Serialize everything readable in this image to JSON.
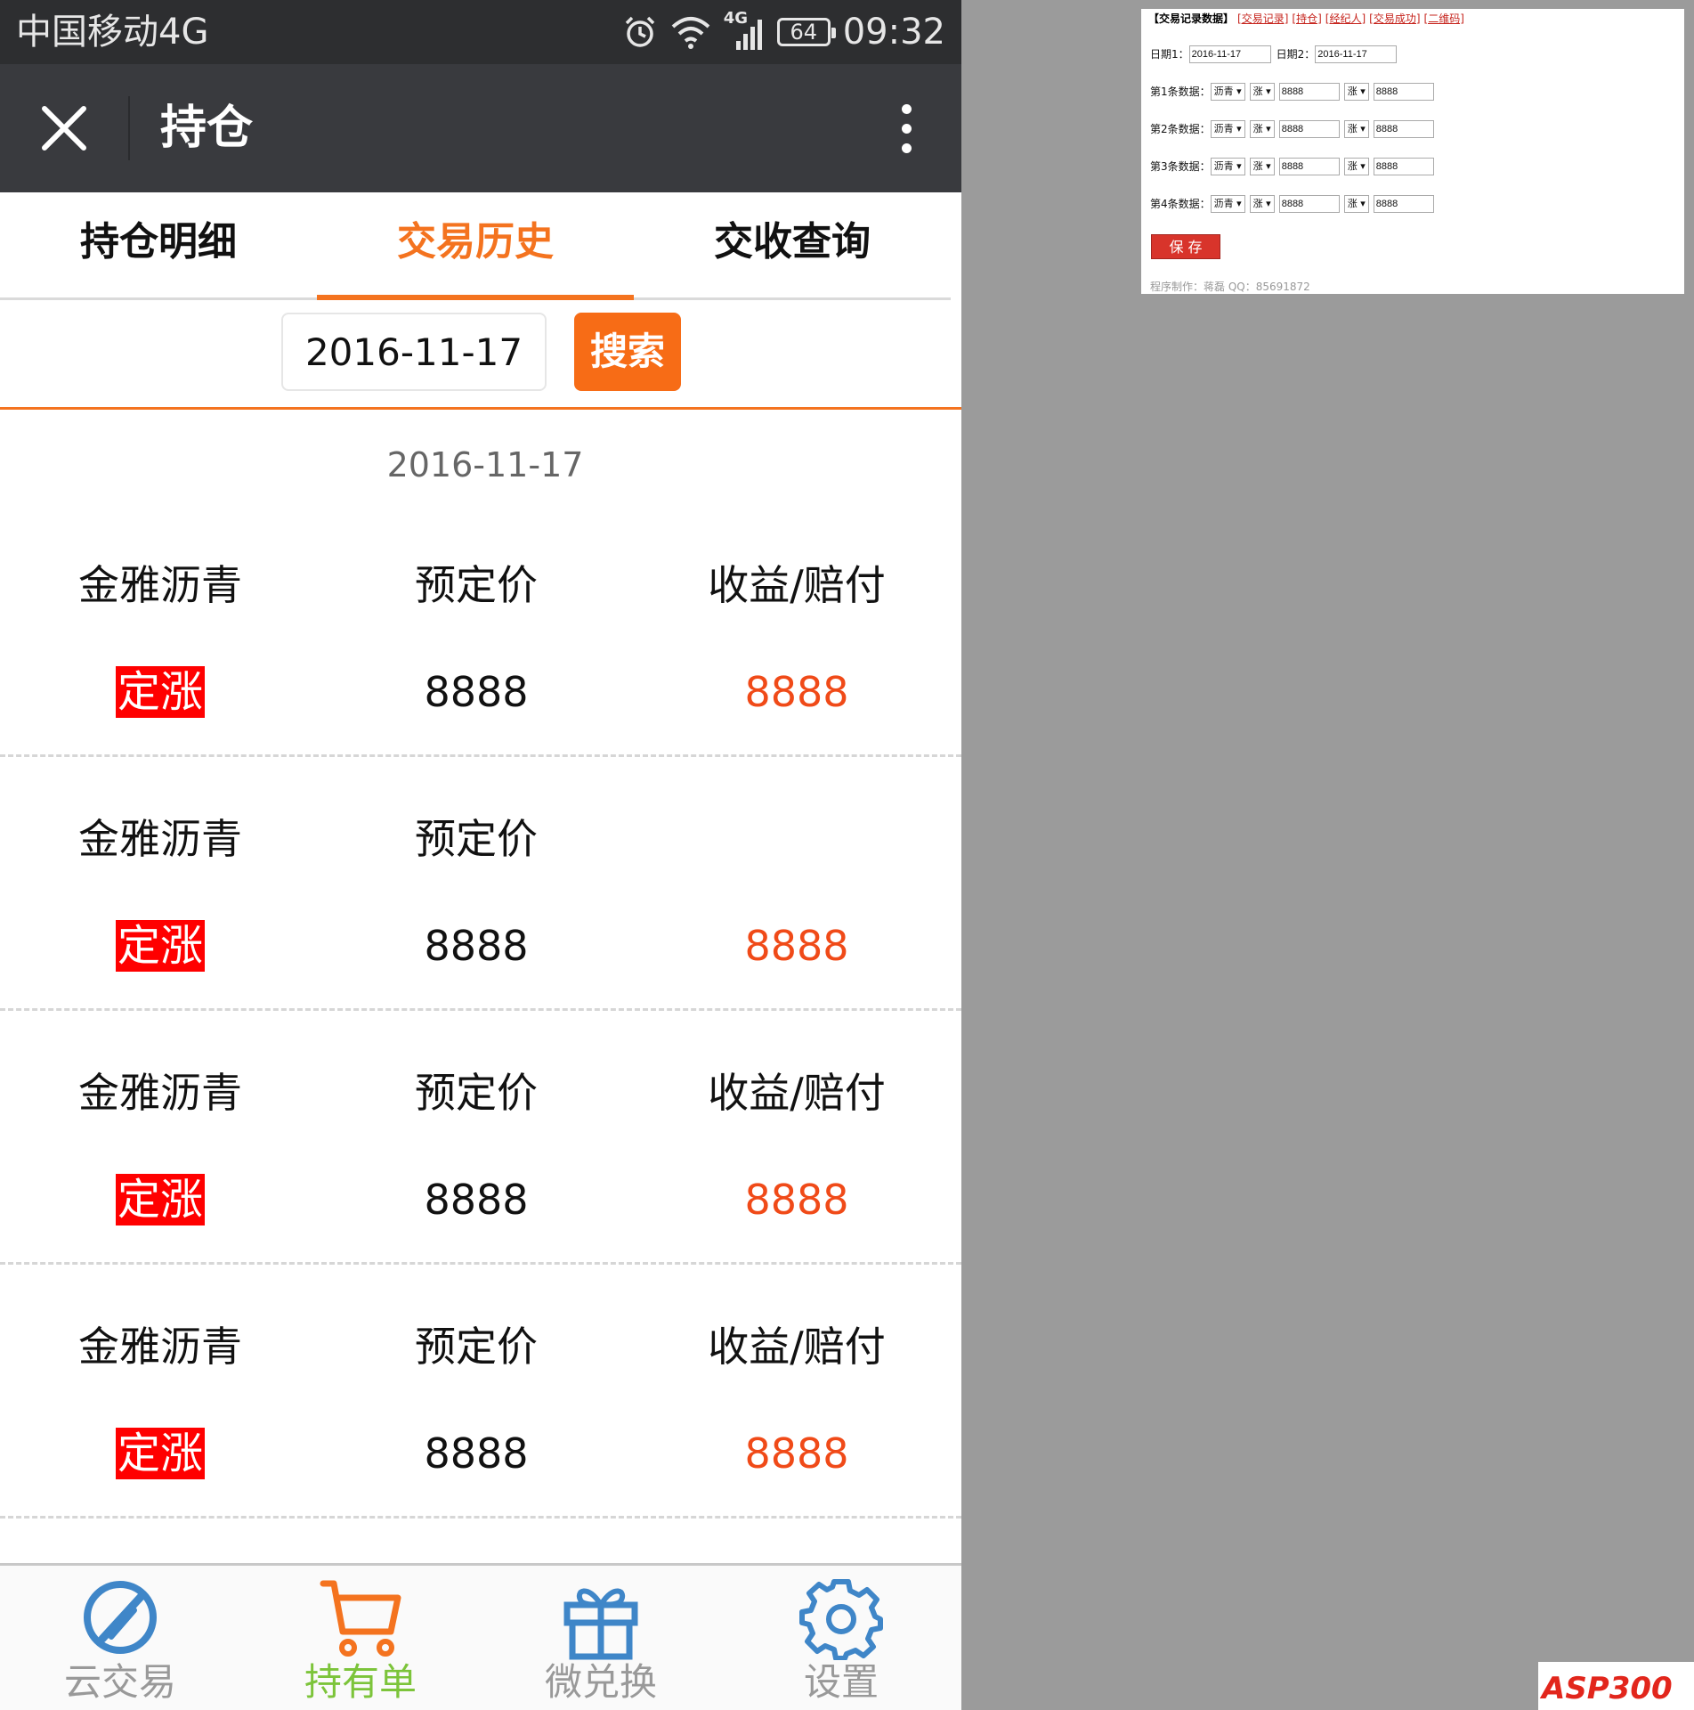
{
  "status_bar": {
    "carrier": "中国移动4G",
    "network": "4G",
    "battery": "64",
    "time": "09:32"
  },
  "top_bar": {
    "title": "持仓"
  },
  "tabs": [
    {
      "label": "持仓明细",
      "active": false
    },
    {
      "label": "交易历史",
      "active": true
    },
    {
      "label": "交收查询",
      "active": false
    }
  ],
  "search": {
    "date_value": "2016-11-17",
    "button_label": "搜索"
  },
  "records_date": "2016-11-17",
  "records": [
    {
      "name": "金雅沥青",
      "price_label": "预定价",
      "result_label": "收益/赔付",
      "type": "定涨",
      "price": "8888",
      "result": "8888"
    },
    {
      "name": "金雅沥青",
      "price_label": "预定价",
      "result_label": "",
      "type": "定涨",
      "price": "8888",
      "result": "8888"
    },
    {
      "name": "金雅沥青",
      "price_label": "预定价",
      "result_label": "收益/赔付",
      "type": "定涨",
      "price": "8888",
      "result": "8888"
    },
    {
      "name": "金雅沥青",
      "price_label": "预定价",
      "result_label": "收益/赔付",
      "type": "定涨",
      "price": "8888",
      "result": "8888"
    }
  ],
  "bottom_nav": [
    {
      "label": "云交易",
      "icon": "cloud-trade-icon",
      "active": false
    },
    {
      "label": "持有单",
      "icon": "cart-icon",
      "active": true
    },
    {
      "label": "微兑换",
      "icon": "gift-icon",
      "active": false
    },
    {
      "label": "设置",
      "icon": "gear-icon",
      "active": false
    }
  ],
  "admin": {
    "header_title": "【交易记录数据】",
    "header_links": [
      "[交易记录]",
      "[持仓]",
      "[经纪人]",
      "[交易成功]",
      "[二维码]"
    ],
    "date1_label": "日期1：",
    "date1_value": "2016-11-17",
    "date2_label": "日期2：",
    "date2_value": "2016-11-17",
    "rows": [
      {
        "label": "第1条数据：",
        "product": "沥青",
        "dir1": "涨",
        "value1": "8888",
        "dir2": "涨",
        "value2": "8888"
      },
      {
        "label": "第2条数据：",
        "product": "沥青",
        "dir1": "涨",
        "value1": "8888",
        "dir2": "涨",
        "value2": "8888"
      },
      {
        "label": "第3条数据：",
        "product": "沥青",
        "dir1": "涨",
        "value1": "8888",
        "dir2": "涨",
        "value2": "8888"
      },
      {
        "label": "第4条数据：",
        "product": "沥青",
        "dir1": "涨",
        "value1": "8888",
        "dir2": "涨",
        "value2": "8888"
      }
    ],
    "save_label": "保 存",
    "credit": "程序制作：蒋磊 QQ：85691872"
  },
  "watermark": {
    "text": "ASP300"
  },
  "colors": {
    "accent_orange": "#f4731f",
    "red_badge": "#ff0000",
    "profit_red": "#f04a18",
    "nav_active_green": "#7cc43a",
    "nav_icon_blue": "#3f86c8"
  }
}
